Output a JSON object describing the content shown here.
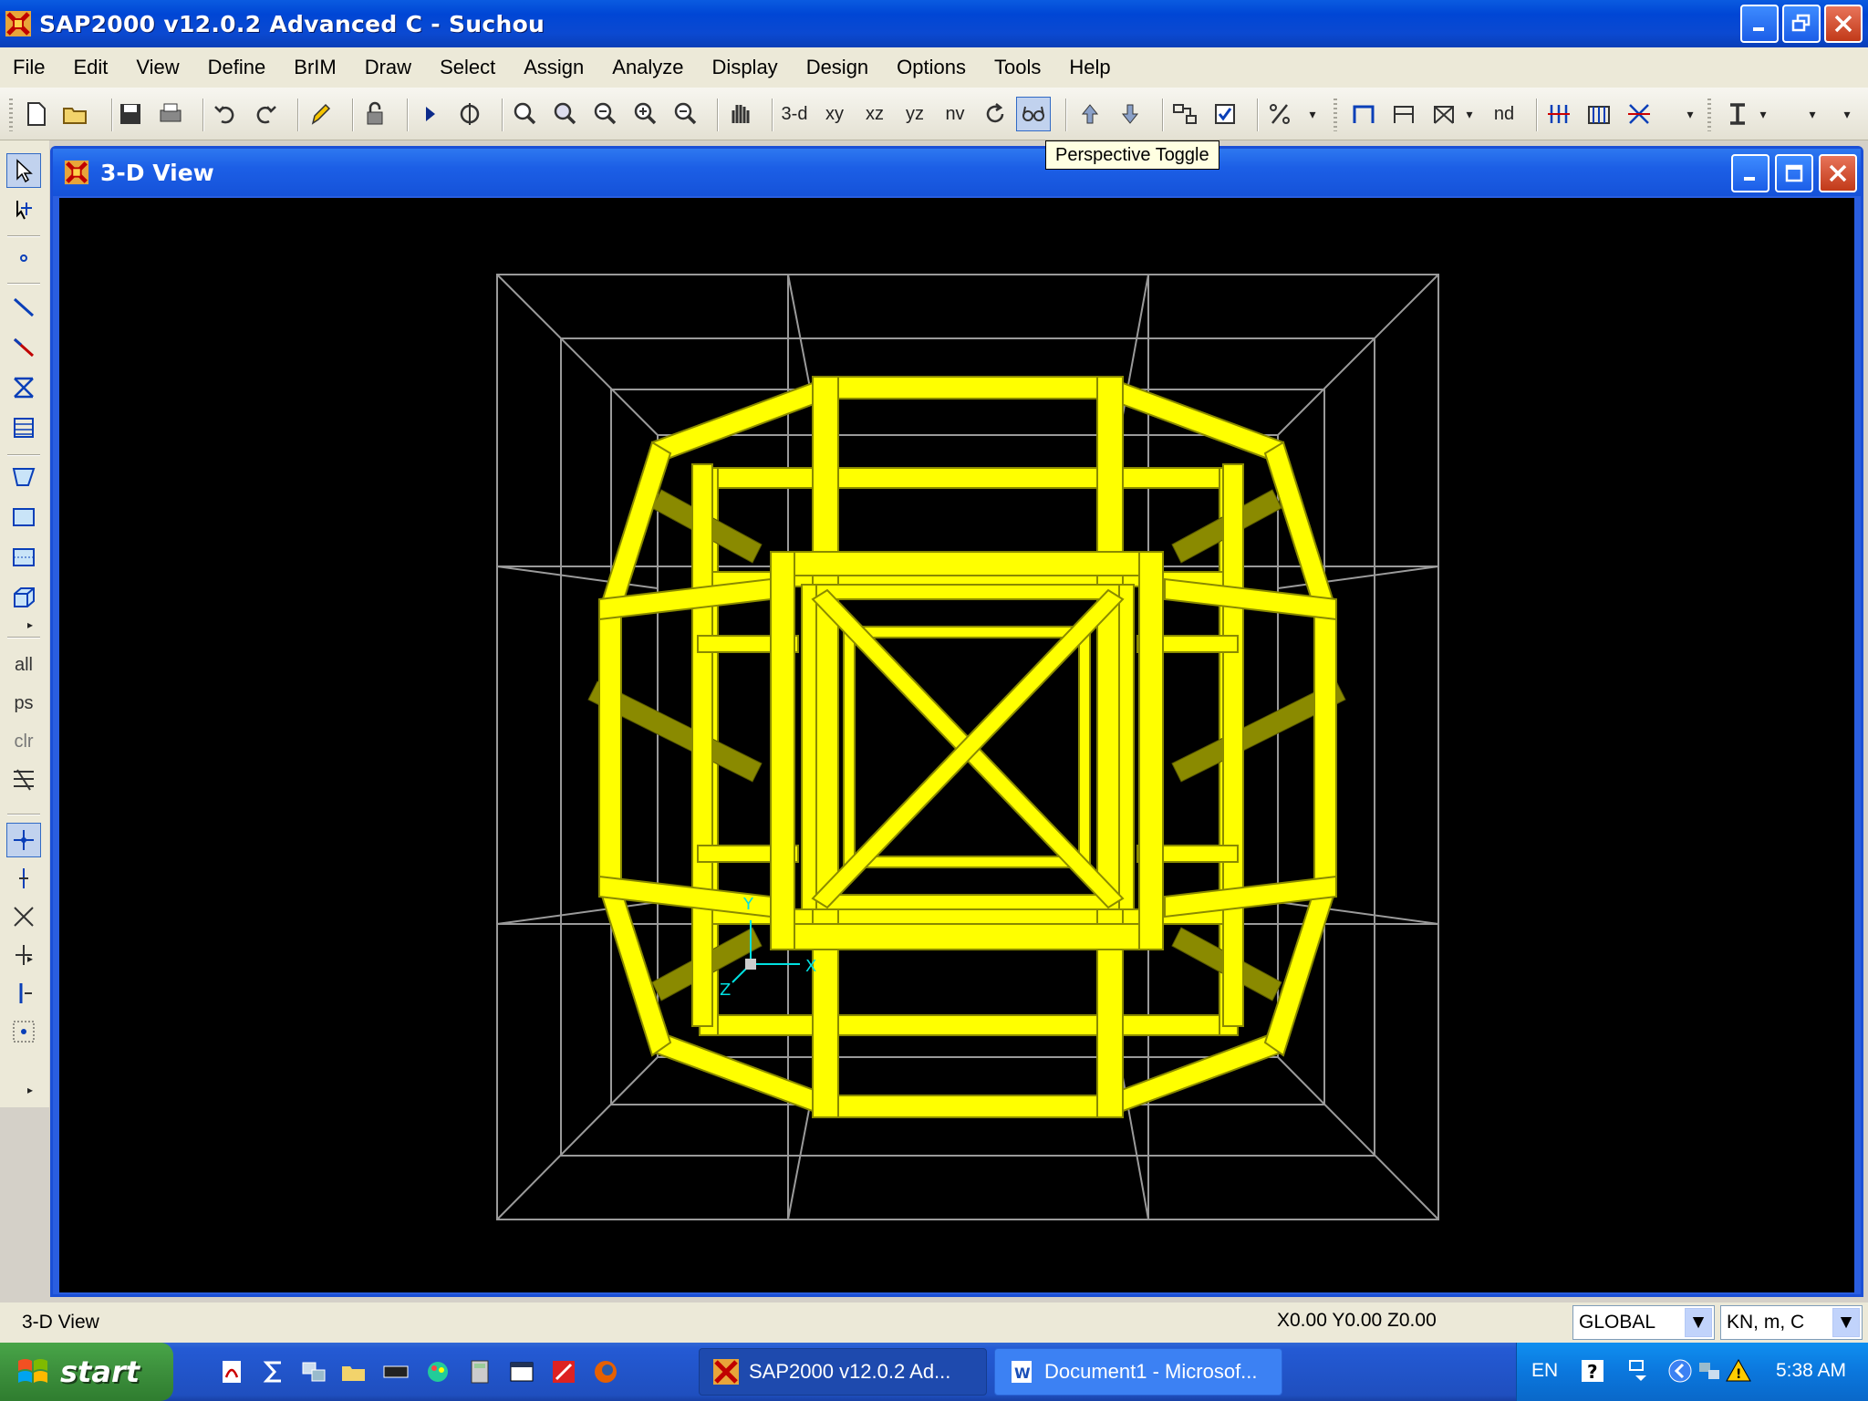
{
  "window": {
    "title": "SAP2000 v12.0.2 Advanced C  - Suchou"
  },
  "menu": [
    "File",
    "Edit",
    "View",
    "Define",
    "BrIM",
    "Draw",
    "Select",
    "Assign",
    "Analyze",
    "Display",
    "Design",
    "Options",
    "Tools",
    "Help"
  ],
  "toolbar": {
    "view_3d": "3-d",
    "view_xy": "xy",
    "view_xz": "xz",
    "view_yz": "yz",
    "view_nv": "nv",
    "view_nd": "nd",
    "tooltip": "Perspective Toggle"
  },
  "left_toolbar": {
    "select_all": "all",
    "select_prev": "ps",
    "clear": "clr"
  },
  "child_window": {
    "title": "3-D View"
  },
  "statusbar": {
    "view_name": "3-D View",
    "coordinates": "X0.00  Y0.00  Z0.00",
    "coord_system": "GLOBAL",
    "units": "KN, m, C"
  },
  "taskbar": {
    "start_label": "start",
    "tasks": [
      {
        "label": "SAP2000 v12.0.2 Ad..."
      },
      {
        "label": "Document1 - Microsof..."
      }
    ],
    "language": "EN",
    "time": "5:38 AM"
  },
  "axes": {
    "x": "X",
    "y": "Y",
    "z": "Z"
  },
  "colors": {
    "structure": "#ffff00",
    "structure_shade": "#8a8a00",
    "grid": "#9a9a9a",
    "canvas_bg": "#000000",
    "axis": "#00e0e0"
  }
}
